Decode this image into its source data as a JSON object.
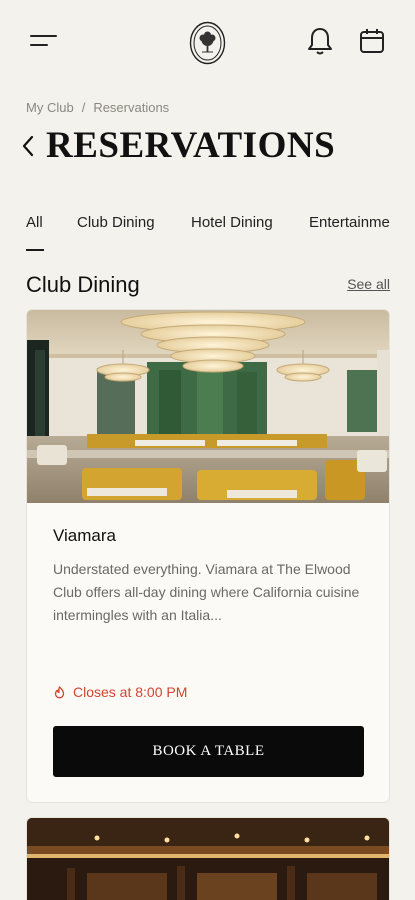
{
  "header": {
    "menu_icon": "hamburger-icon",
    "logo_icon": "club-crest-logo",
    "notifications_icon": "bell-icon",
    "calendar_icon": "calendar-icon"
  },
  "breadcrumb": {
    "items": [
      "My Club",
      "Reservations"
    ],
    "separator": "/"
  },
  "page": {
    "title": "RESERVATIONS",
    "back_icon": "chevron-left-icon"
  },
  "tabs": [
    {
      "label": "All",
      "active": true
    },
    {
      "label": "Club Dining"
    },
    {
      "label": "Hotel Dining"
    },
    {
      "label": "Entertainme"
    }
  ],
  "section": {
    "title": "Club Dining",
    "see_all": "See all"
  },
  "cards": [
    {
      "name": "Viamara",
      "description": "Understated everything. Viamara at The Elwood Club offers all-day dining where California cuisine intermingles with an Italia...",
      "status": "Closes at 8:00 PM",
      "status_icon": "clock-icon",
      "button_label": "BOOK A TABLE"
    }
  ],
  "colors": {
    "background": "#f4f2ec",
    "status": "#d2452f",
    "button": "#0a0a0a"
  }
}
